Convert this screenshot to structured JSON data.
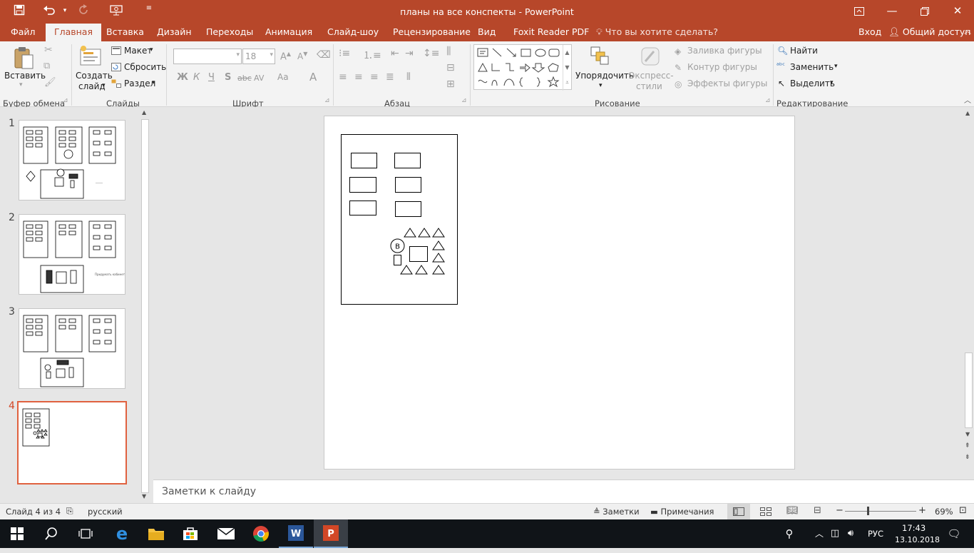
{
  "window": {
    "title": "планы на все конспекты - PowerPoint"
  },
  "tabs": [
    "Файл",
    "Главная",
    "Вставка",
    "Дизайн",
    "Переходы",
    "Анимация",
    "Слайд-шоу",
    "Рецензирование",
    "Вид",
    "Foxit Reader PDF"
  ],
  "search_tell": "Что вы хотите сделать?",
  "account": {
    "signin": "Вход",
    "share": "Общий доступ"
  },
  "ribbon": {
    "clipboard": {
      "paste": "Вставить",
      "label": "Буфер обмена"
    },
    "slides": {
      "new_slide_1": "Создать",
      "new_slide_2": "слайд",
      "layout": "Макет",
      "reset": "Сбросить",
      "section": "Раздел",
      "label": "Слайды"
    },
    "font": {
      "size": "18",
      "bold": "Ж",
      "italic": "К",
      "underline": "Ч",
      "shadow": "S",
      "strike": "abc",
      "spacing": "AV",
      "case": "Aa",
      "color": "A",
      "label": "Шрифт"
    },
    "paragraph": {
      "label": "Абзац"
    },
    "drawing": {
      "arrange": "Упорядочить",
      "styles_1": "Экспресс-",
      "styles_2": "стили",
      "fill": "Заливка фигуры",
      "outline": "Контур фигуры",
      "effects": "Эффекты фигуры",
      "label": "Рисование"
    },
    "editing": {
      "find": "Найти",
      "replace": "Заменить",
      "select": "Выделить",
      "label": "Редактирование"
    }
  },
  "slides": [
    {
      "number": "1",
      "side_text": "_____"
    },
    {
      "number": "2",
      "side_text": "Придумать\nкабинет"
    },
    {
      "number": "3",
      "side_text": ""
    },
    {
      "number": "4",
      "side_text": ""
    }
  ],
  "current_slide": {
    "circle_label": "В"
  },
  "notes_placeholder": "Заметки к слайду",
  "status": {
    "slide": "Слайд 4 из 4",
    "language": "русский",
    "notes": "Заметки",
    "comments": "Примечания",
    "zoom": "69%"
  },
  "taskbar": {
    "input_lang": "РУС",
    "time": "17:43",
    "date": "13.10.2018"
  }
}
